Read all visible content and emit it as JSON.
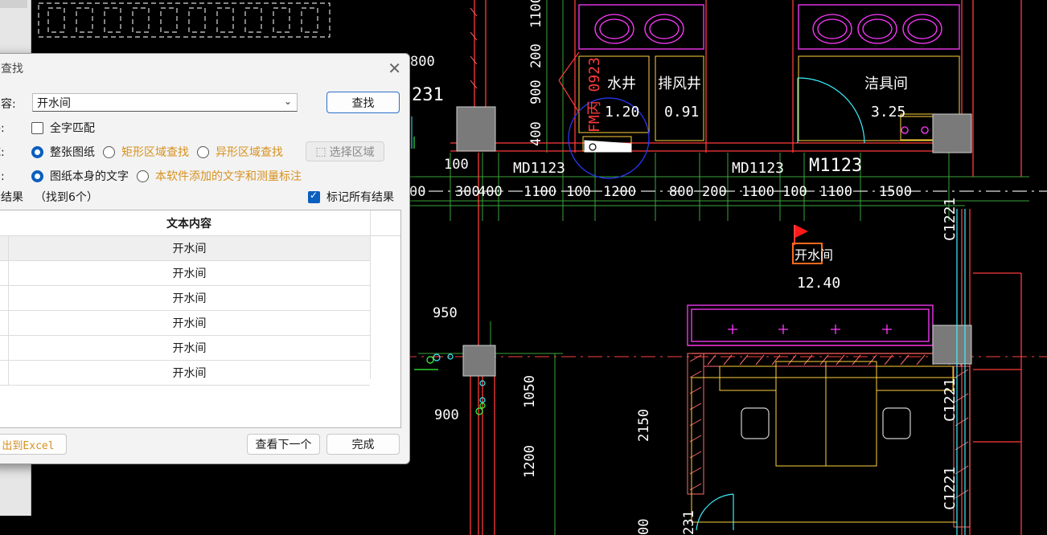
{
  "app": {
    "title": "文字查找"
  },
  "dialog": {
    "title_visible": "字查找",
    "close_icon": "close-icon",
    "content_label": "内容:",
    "content_value": "开水间",
    "search_button": "查找",
    "condition_label": "件:",
    "whole_word_label": "全字匹配",
    "whole_word_checked": false,
    "area_label": "域:",
    "area_options": [
      "整张图纸",
      "矩形区域查找",
      "异形区域查找"
    ],
    "area_selected": 0,
    "select_area_button": "选择区域",
    "scope_label": "围:",
    "scope_options": [
      "图纸本身的文字",
      "本软件添加的文字和测量标注"
    ],
    "scope_selected": 0,
    "results_label": "示结果",
    "results_count": "（找到6个）",
    "mark_all_label": "标记所有结果",
    "mark_all_checked": true,
    "table_header": "文本内容",
    "rows": [
      "开水间",
      "开水间",
      "开水间",
      "开水间",
      "开水间",
      "开水间"
    ],
    "export_button": "出到Excel",
    "next_button": "查看下一个",
    "done_button": "完成"
  },
  "cad": {
    "labels": {
      "water_well": "水井",
      "water_well_area": "1.20",
      "vent_well": "排风井",
      "vent_well_area": "0.91",
      "clean_room": "洁具间",
      "clean_room_area": "3.25",
      "boiler_room": "开水间",
      "boiler_room_area": "12.40",
      "door_fm": "FM丙 0923",
      "door_md1": "MD1123",
      "door_md2": "MD1123",
      "door_m": "M1123",
      "win_c1": "C1221",
      "win_c2": "C1221",
      "win_c3": "C1221"
    },
    "dims_top": [
      "100",
      "300",
      "400",
      "1100",
      "100",
      "1200",
      "800",
      "200",
      "1100",
      "100",
      "1100",
      "1500",
      "00"
    ],
    "dims_left": [
      "800",
      "231",
      "100",
      "950",
      "900",
      "231"
    ],
    "dims_vertical": [
      "1100",
      "200",
      "900",
      "400",
      "1050",
      "1200",
      "2150",
      "00"
    ],
    "colors": {
      "accent": "#0a5fbf",
      "orange": "#d7911f",
      "wall": "#ff3b3b",
      "magenta": "#ff3bff",
      "green": "#3bff3b"
    }
  }
}
